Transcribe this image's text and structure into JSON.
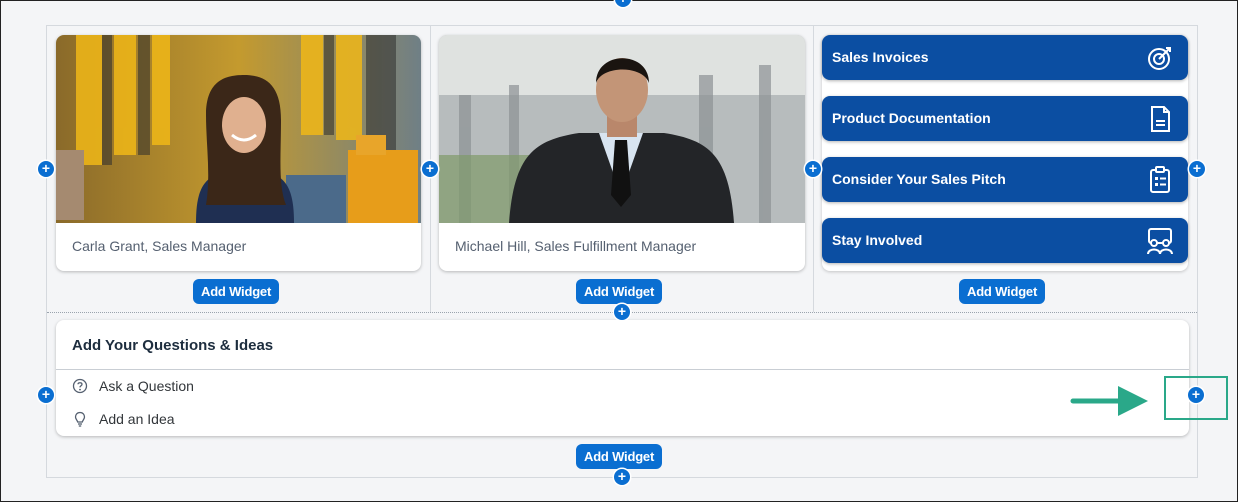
{
  "people": [
    {
      "caption": "Carla Grant, Sales Manager"
    },
    {
      "caption": "Michael Hill, Sales Fulfillment Manager"
    }
  ],
  "tiles": [
    {
      "label": "Sales Invoices",
      "icon": "target-icon"
    },
    {
      "label": "Product Documentation",
      "icon": "document-icon"
    },
    {
      "label": "Consider Your Sales Pitch",
      "icon": "clipboard-icon"
    },
    {
      "label": "Stay Involved",
      "icon": "people-icon"
    }
  ],
  "add_widget_label": "Add Widget",
  "add_section_symbol": "+",
  "qa": {
    "title": "Add Your Questions & Ideas",
    "items": [
      {
        "label": "Ask a Question",
        "icon": "question-icon"
      },
      {
        "label": "Add an Idea",
        "icon": "lightbulb-icon"
      }
    ]
  },
  "colors": {
    "accent": "#0a6ed1",
    "tile": "#0b4ea2",
    "highlight": "#2aa889"
  }
}
